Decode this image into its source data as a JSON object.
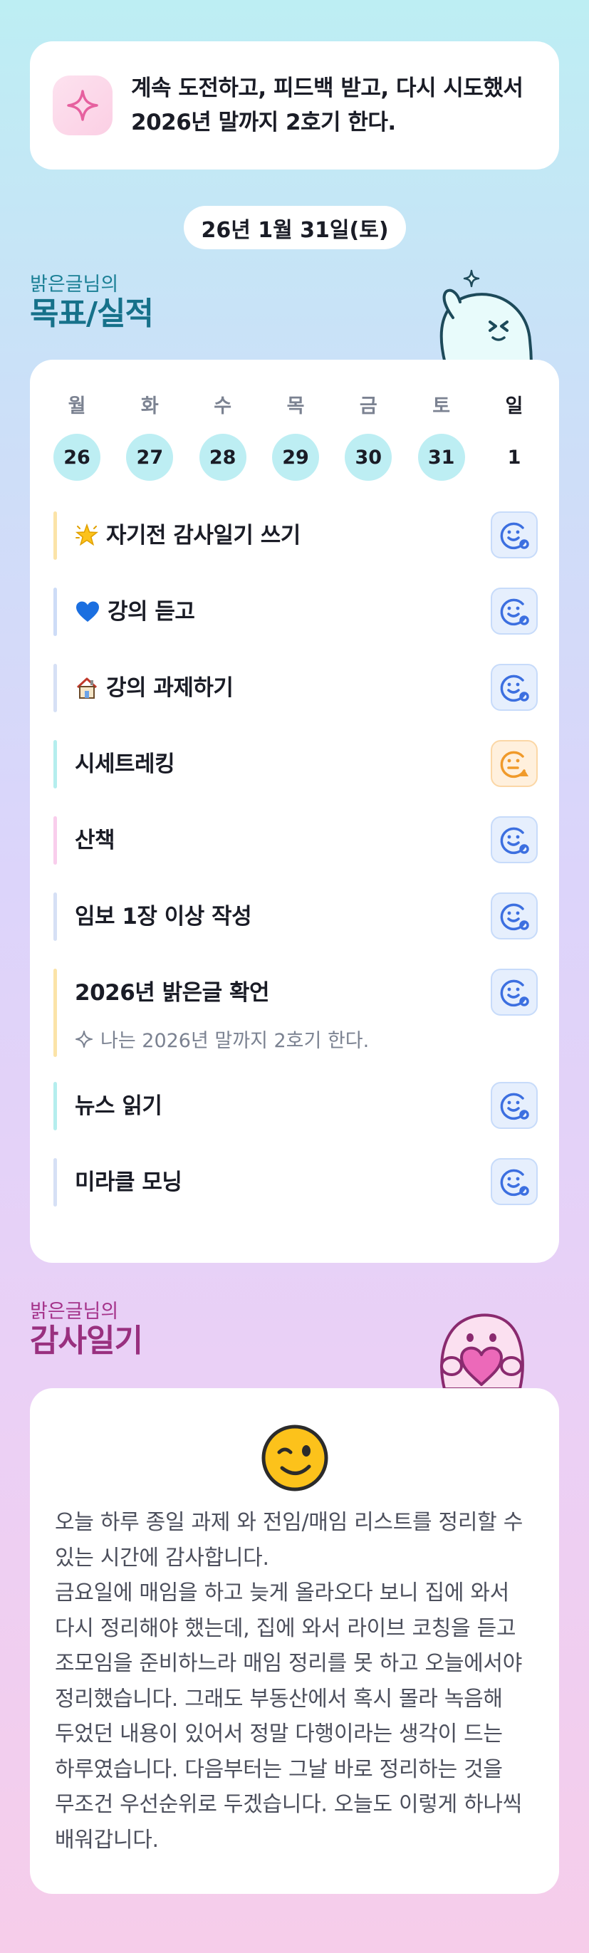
{
  "motto": {
    "text": "계속 도전하고, 피드백 받고, 다시 시도했서 2026년 말까지 2호기 한다."
  },
  "date": "26년 1월 31일(토)",
  "goals_section": {
    "subtitle": "밝은글님의",
    "title": "목표/실적"
  },
  "week": [
    {
      "day": "월",
      "num": "26",
      "highlight": true
    },
    {
      "day": "화",
      "num": "27",
      "highlight": true
    },
    {
      "day": "수",
      "num": "28",
      "highlight": true
    },
    {
      "day": "목",
      "num": "29",
      "highlight": true
    },
    {
      "day": "금",
      "num": "30",
      "highlight": true
    },
    {
      "day": "토",
      "num": "31",
      "highlight": true
    },
    {
      "day": "일",
      "num": "1",
      "highlight": false
    }
  ],
  "goals": [
    {
      "title": "자기전 감사일기 쓰기",
      "emoji": "star-sparkle-icon",
      "bar_color": "#fbe3a8",
      "status": "done"
    },
    {
      "title": "강의 듣고",
      "emoji": "blue-heart-icon",
      "bar_color": "#cddcf7",
      "status": "done"
    },
    {
      "title": "강의 과제하기",
      "emoji": "house-icon",
      "bar_color": "#d6e0f5",
      "status": "done"
    },
    {
      "title": "시세트레킹",
      "emoji": "",
      "bar_color": "#b5eeee",
      "status": "warning"
    },
    {
      "title": "산책",
      "emoji": "",
      "bar_color": "#f9cdec",
      "status": "done"
    },
    {
      "title": "임보 1장 이상 작성",
      "emoji": "",
      "bar_color": "#d6e0f5",
      "status": "done"
    },
    {
      "title": "2026년 밝은글 확언",
      "emoji": "",
      "bar_color": "#fbe3a8",
      "status": "done",
      "subtitle": "나는 2026년 말까지 2호기 한다."
    },
    {
      "title": "뉴스 읽기",
      "emoji": "",
      "bar_color": "#b5eeee",
      "status": "done"
    },
    {
      "title": "미라클 모닝",
      "emoji": "",
      "bar_color": "#d6e0f5",
      "status": "done"
    }
  ],
  "thanks_section": {
    "subtitle": "밝은글님의",
    "title": "감사일기"
  },
  "diary": {
    "mood": "winking-face-icon",
    "text": "오늘 하루 종일 과제 와 전임/매임 리스트를 정리할 수 있는 시간에 감사합니다.\n금요일에 매임을 하고 늦게 올라오다 보니 집에 와서 다시 정리해야 했는데, 집에 와서 라이브 코칭을 듣고 조모임을 준비하느라 매임 정리를 못 하고 오늘에서야 정리했습니다. 그래도 부동산에서 혹시 몰라 녹음해 두었던 내용이 있어서 정말 다행이라는 생각이 드는 하루였습니다. 다음부터는 그날 바로 정리하는 것을 무조건 우선순위로 두겠습니다. 오늘도 이렇게 하나씩 배워갑니다."
  },
  "colors": {
    "accent_teal": "#16718a",
    "accent_magenta": "#99307f",
    "day_highlight": "#bdeef3",
    "status_done": "#3c6fe0",
    "status_warning": "#f09a2a"
  }
}
